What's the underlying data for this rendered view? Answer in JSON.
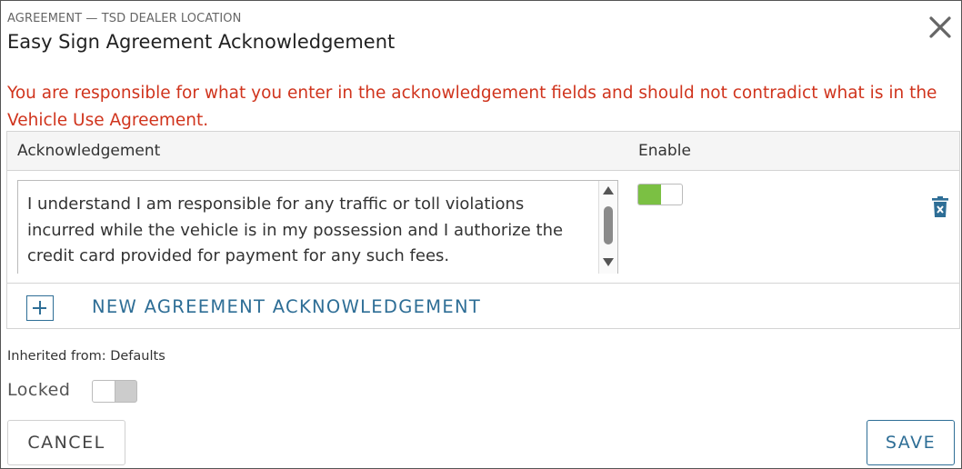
{
  "header": {
    "breadcrumb": "AGREEMENT — TSD DEALER LOCATION",
    "title": "Easy Sign Agreement Acknowledgement",
    "close_icon": "close-icon"
  },
  "warning": "You are responsible for what you enter in the acknowledgement fields and should not contradict what is in the Vehicle Use Agreement.",
  "table": {
    "columns": [
      "Acknowledgement",
      "Enable"
    ],
    "rows": [
      {
        "text": "I understand I am responsible for any traffic or toll violations incurred while the vehicle is in my possession and I authorize the credit card provided for payment for any such fees.",
        "enabled": true,
        "delete_icon": "trash-icon"
      }
    ],
    "add_label": "NEW AGREEMENT ACKNOWLEDGEMENT",
    "add_icon": "plus-icon"
  },
  "inherited": "Inherited from: Defaults",
  "locked": {
    "label": "Locked",
    "value": false
  },
  "buttons": {
    "cancel": "CANCEL",
    "save": "SAVE"
  },
  "colors": {
    "warning": "#d0341d",
    "accent": "#2e6e96",
    "toggle_on": "#7bc043",
    "delete_icon": "#2e6e96"
  }
}
